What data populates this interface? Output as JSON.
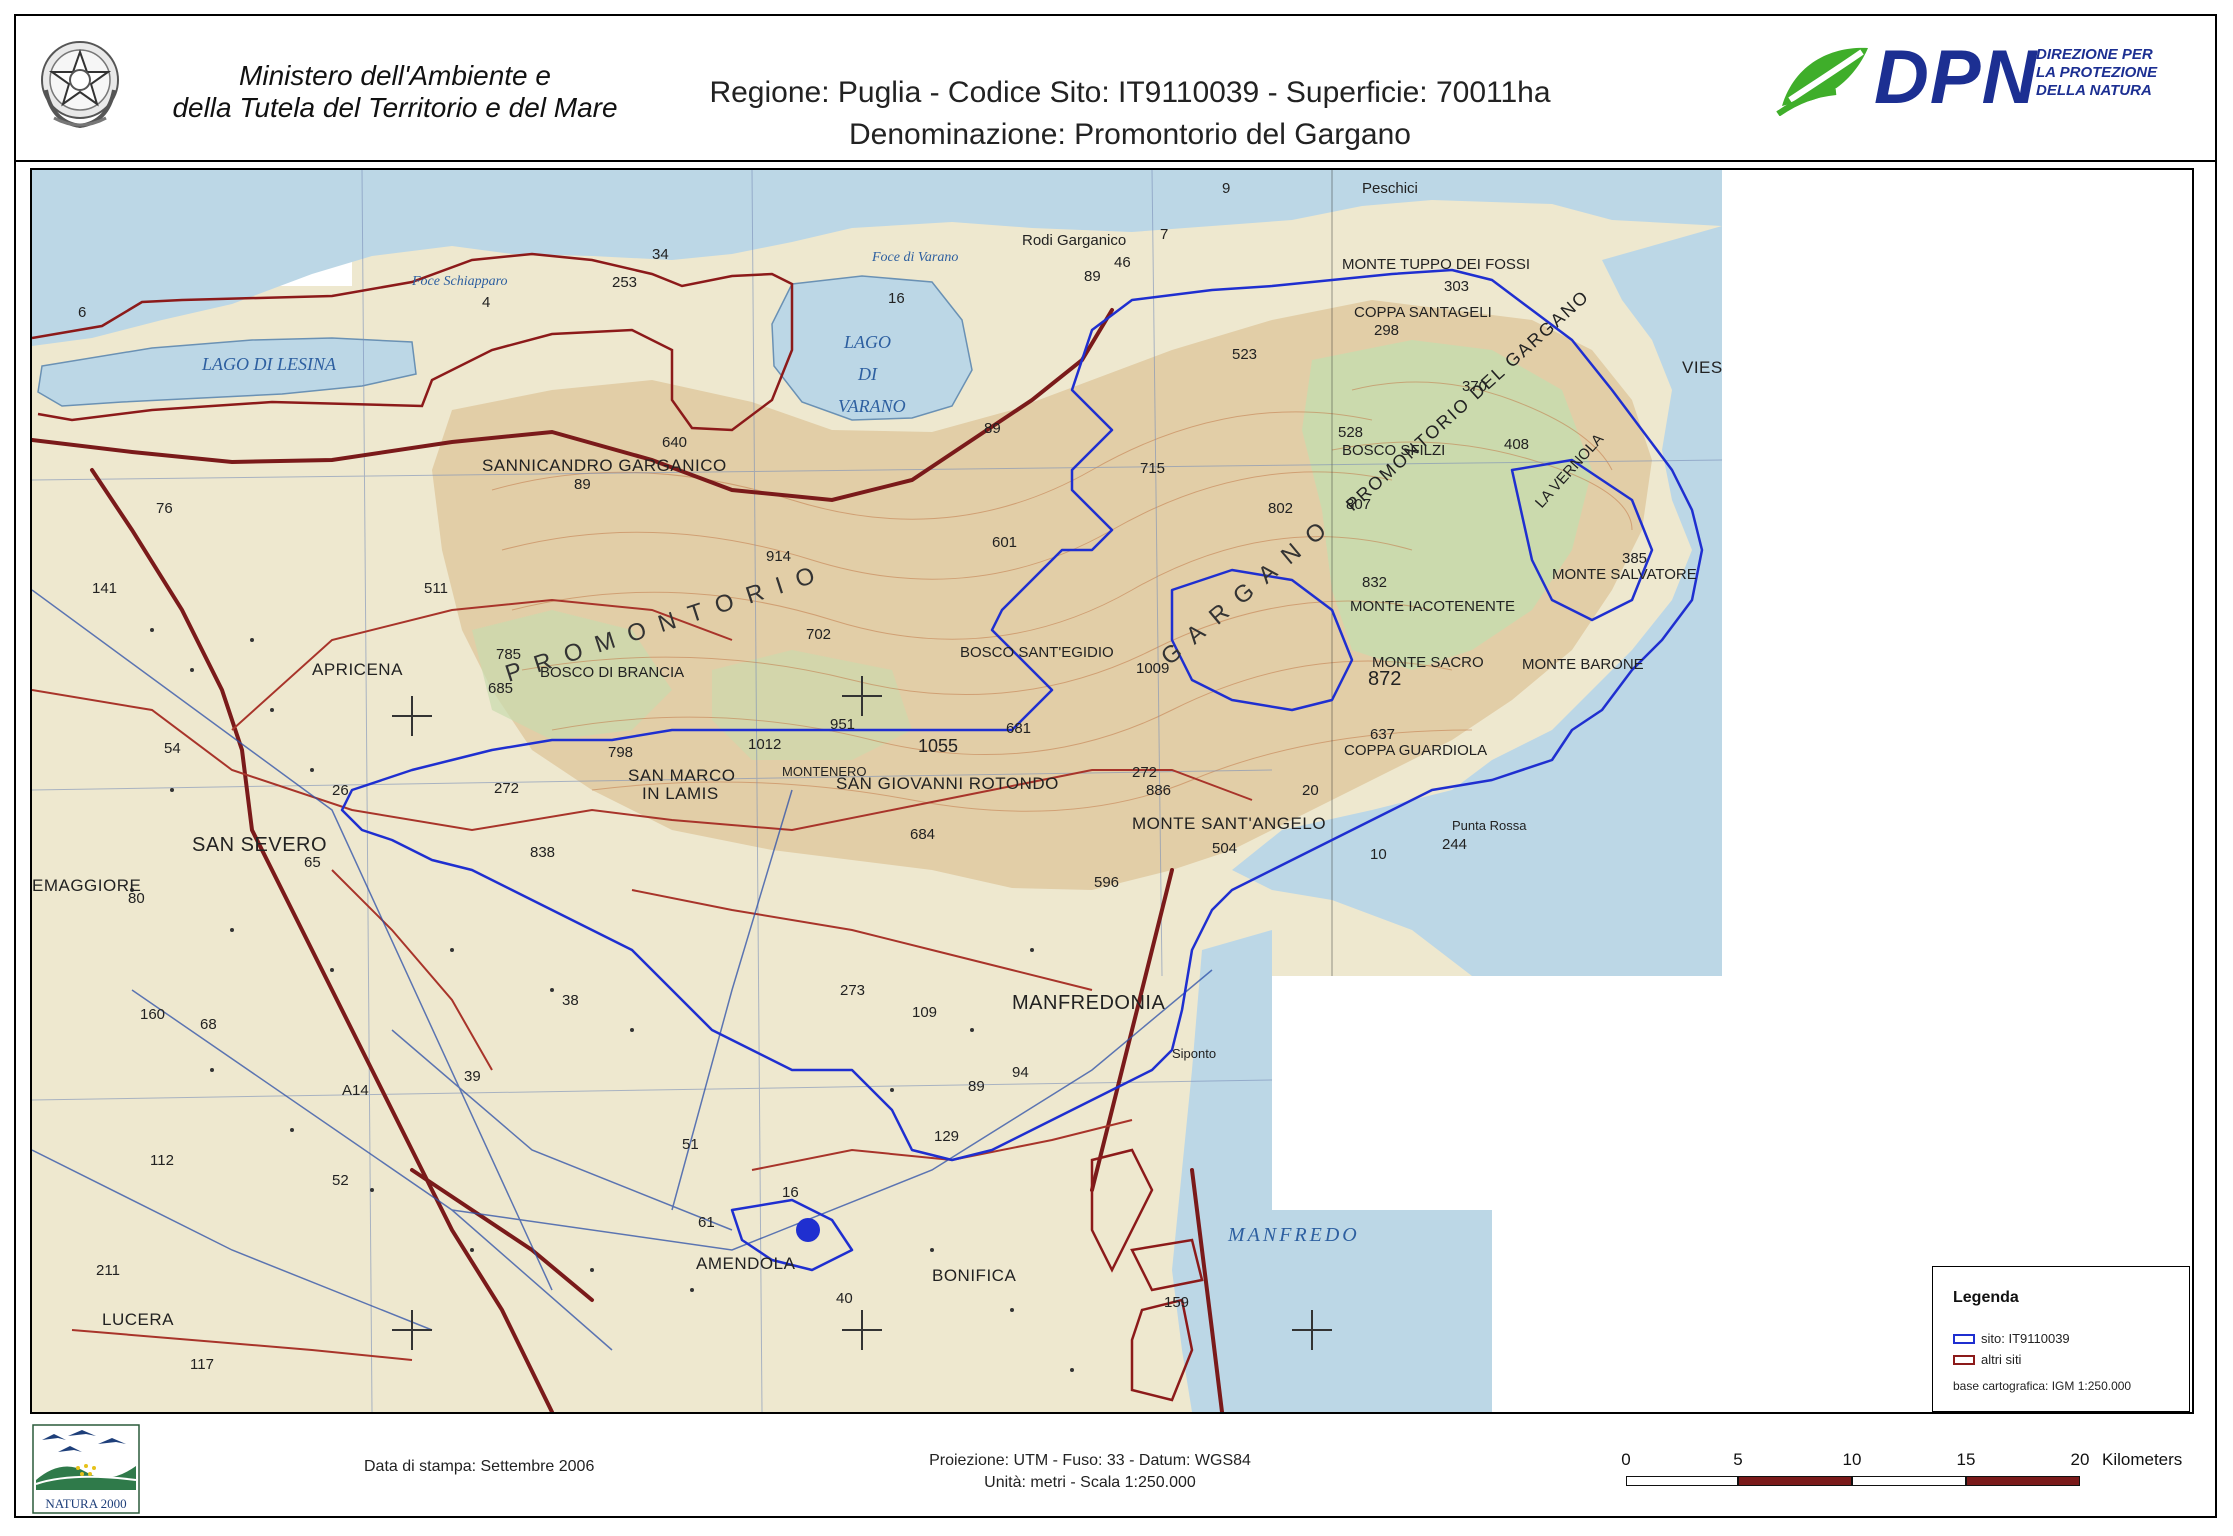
{
  "header": {
    "ministry_line_1": "Ministero dell'Ambiente e",
    "ministry_line_2": "della Tutela del Territorio e del Mare",
    "site_line_1": "Regione: Puglia - Codice Sito: IT9110039 - Superficie: 70011ha",
    "site_line_2": "Denominazione: Promontorio del Gargano",
    "dpn_logo_text": "DPN",
    "dpn_tagline_1": "DIREZIONE PER",
    "dpn_tagline_2": "LA PROTEZIONE",
    "dpn_tagline_3": "DELLA NATURA",
    "emblem_icon": "italian-republic-emblem-icon",
    "dpn_icon": "green-leaf-icon"
  },
  "map": {
    "places": {
      "lago_lesina": "LAGO DI LESINA",
      "lago_varano_1": "LAGO",
      "lago_varano_2": "DI",
      "lago_varano_3": "VARANO",
      "foce_schiapparo": "Foce Schiapparo",
      "foce_varano": "Foce di Varano",
      "rodi": "Rodi Garganico",
      "peschici": "Peschici",
      "vieste": "VIES",
      "sannicandro": "SANNICANDRO GARGANICO",
      "apricena": "APRICENA",
      "san_severo": "SAN SEVERO",
      "san_marco": "SAN MARCO",
      "in_lamis": "IN LAMIS",
      "san_giovanni": "SAN GIOVANNI ROTONDO",
      "monte_santangelo": "MONTE SANT'ANGELO",
      "manfredonia": "MANFREDONIA",
      "manfredonia_gulf": "MANFREDO",
      "lucera": "LUCERA",
      "amendola": "AMENDOLA",
      "bonifica": "BONIFICA",
      "torremaggiore": "EMAGGIORE",
      "monte_tuppo": "MONTE TUPPO DEI FOSSI",
      "coppa_santa": "COPPA SANTAGELI",
      "bosco_sfilzi": "BOSCO SFILZI",
      "promontorio_label": "PROMONTORIO DEL GARGANO",
      "la_vernola": "LA VERNOLA",
      "monte_salvatore": "MONTE SALVATORE",
      "monte_iacotenente": "MONTE IACOTENENTE",
      "monte_sacro": "MONTE SACRO",
      "monte_barone": "MONTE BARONE",
      "coppa_guardiola": "COPPA GUARDIOLA",
      "bosco_brancia": "BOSCO DI BRANCIA",
      "bosco_egidio": "BOSCO SANT'EGIDIO",
      "montenero": "MONTENERO",
      "promontorio_big": "PROMONTORIO",
      "gargano_big": "GARGANO",
      "punta_rossa": "Punta Rossa",
      "siponto": "Siponto"
    },
    "elevations": {
      "e253": "253",
      "e34": "34",
      "e46": "46",
      "e523": "523",
      "e298": "298",
      "e303": "303",
      "e370": "370",
      "e408": "408",
      "e715": "715",
      "e807": "807",
      "e802": "802",
      "e832": "832",
      "e385": "385",
      "e872": "872",
      "e637": "637",
      "e640": "640",
      "e914": "914",
      "e601": "601",
      "e702": "702",
      "e511": "511",
      "e785": "785",
      "e685": "685",
      "e798": "798",
      "e1012": "1012",
      "e951": "951",
      "e1055": "1055",
      "e681": "681",
      "e886": "886",
      "e684": "684",
      "e838": "838",
      "e596": "596",
      "e504": "504",
      "e244": "244",
      "e109": "109",
      "e38": "38",
      "e68": "68",
      "e39": "39",
      "e94": "94",
      "e129": "129",
      "e51": "51",
      "e61": "61",
      "e40": "40",
      "e211": "211",
      "e117": "117",
      "e52": "52",
      "e112": "112",
      "e141": "141",
      "e76": "76",
      "e65": "65",
      "e80": "80",
      "e54": "54",
      "e26": "26",
      "e6": "6",
      "e16": "16",
      "e4": "4",
      "e7": "7",
      "e9": "9",
      "e10": "10",
      "e20": "20",
      "e1009": "1009"
    },
    "roads": {
      "r89a": "89",
      "r89b": "89",
      "r89c": "89",
      "r89d": "89",
      "r528": "528",
      "r272a": "272",
      "r272b": "272",
      "r273": "273",
      "r159": "159",
      "rA14": "A14",
      "r160": "160",
      "r16": "16"
    },
    "colors": {
      "sea": "#bcd7e6",
      "land": "#eee8cf",
      "relief": "#dfc9a0",
      "forest": "#c9dcae",
      "site_boundary": "#1f2fd0",
      "other_sites": "#8c1a1a",
      "road": "#7a1a1a",
      "contour": "#c27a4a"
    }
  },
  "legend": {
    "title": "Legenda",
    "site_label": "sito: IT9110039",
    "other_label": "altri siti",
    "base": "base cartografica: IGM 1:250.000"
  },
  "footer": {
    "print_date": "Data di stampa: Settembre 2006",
    "projection_1": "Proiezione: UTM - Fuso: 33 - Datum: WGS84",
    "projection_2": "Unità: metri - Scala 1:250.000",
    "natura_text": "NATURA 2000",
    "natura_icon": "natura-2000-birds-icon"
  },
  "scalebar": {
    "ticks": [
      "0",
      "5",
      "10",
      "15",
      "20"
    ],
    "units": "Kilometers"
  }
}
